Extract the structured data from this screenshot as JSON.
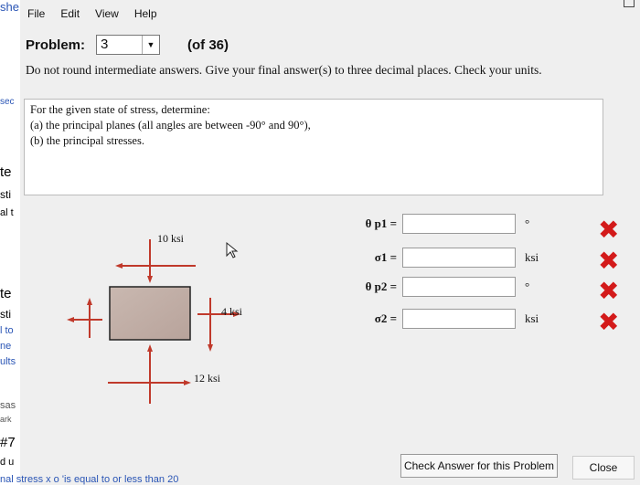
{
  "menu": [
    "File",
    "Edit",
    "View",
    "Help"
  ],
  "problem": {
    "label": "Problem:",
    "selected": "3",
    "of_label": "(of 36)",
    "instructions": "Do not round intermediate answers.  Give your final answer(s) to three decimal places.  Check your units."
  },
  "statement": {
    "intro": "For the given state of stress, determine:",
    "part_a": "(a) the principal planes (all angles are between -90° and 90°),",
    "part_b": "(b) the principal stresses."
  },
  "diagram": {
    "stress_top": "10 ksi",
    "stress_right": "4 ksi",
    "stress_bottom": "12 ksi"
  },
  "answers": [
    {
      "label": "θ p1 =",
      "unit": "°"
    },
    {
      "label": "σ1 =",
      "unit": "ksi"
    },
    {
      "label": "θ p2 =",
      "unit": "°"
    },
    {
      "label": "σ2 =",
      "unit": "ksi"
    }
  ],
  "status_mark": "✖",
  "buttons": {
    "check": "Check Answer for this Problem",
    "close": "Close"
  },
  "background_fragments": [
    "she",
    "sec",
    "te",
    "sti",
    "al t",
    "te",
    "sti",
    "l to",
    "ne",
    "ults",
    "sas",
    "ark",
    "#7",
    "d u",
    "nal stress x o 'is equal to or less than 20"
  ],
  "colors": {
    "wrong": "#d31a1a",
    "link": "#2a55b5"
  }
}
